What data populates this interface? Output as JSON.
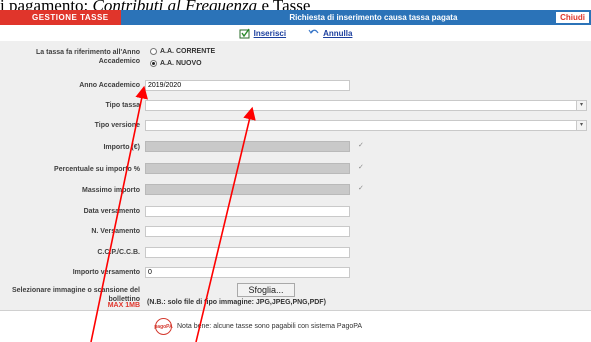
{
  "caption": {
    "prefix": "i pagamento: ",
    "italic": "Contributi al Frequenza",
    "suffix": " e Tasse"
  },
  "header": {
    "tab_label": "GESTIONE TASSE",
    "title": "Richiesta di inserimento causa tassa pagata",
    "close_label": "Chiudi"
  },
  "toolbar": {
    "insert_label": "Inserisci",
    "cancel_label": "Annulla"
  },
  "form": {
    "year_ref_label": "La tassa fa riferimento all'Anno Accademico",
    "radio_current": "A.A. CORRENTE",
    "radio_previous": "A.A. NUOVO",
    "year_label": "Anno Accademico",
    "year_value": "2019/2020",
    "tipo_tassa_label": "Tipo tassa",
    "tipo_versione_label": "Tipo versione",
    "importo_label": "Importo (€)",
    "percentuale_label": "Percentuale su importo %",
    "massimo_label": "Massimo importo",
    "data_label": "Data versamento",
    "numero_label": "N. Versamento",
    "ccp_label": "C.C.P./C.C.B.",
    "importo_versamento_label": "Importo versamento",
    "importo_versamento_value": "0",
    "allegato_label": "Selezionare immagine o scansione del bollettino",
    "max_label": "MAX 1MB",
    "browse_label": "Sfoglia...",
    "file_note": "(N.B.: solo file di tipo immagine: JPG,JPEG,PNG,PDF)"
  },
  "footer": {
    "note": "Nota bene: alcune tasse sono pagabili con sistema PagoPA",
    "icon_text": "pagoPA"
  },
  "colors": {
    "topbar": "#2b73b8",
    "tab_red": "#e0352b",
    "link_blue": "#1c3f9e",
    "annotation_arrow": "#ff0000"
  }
}
